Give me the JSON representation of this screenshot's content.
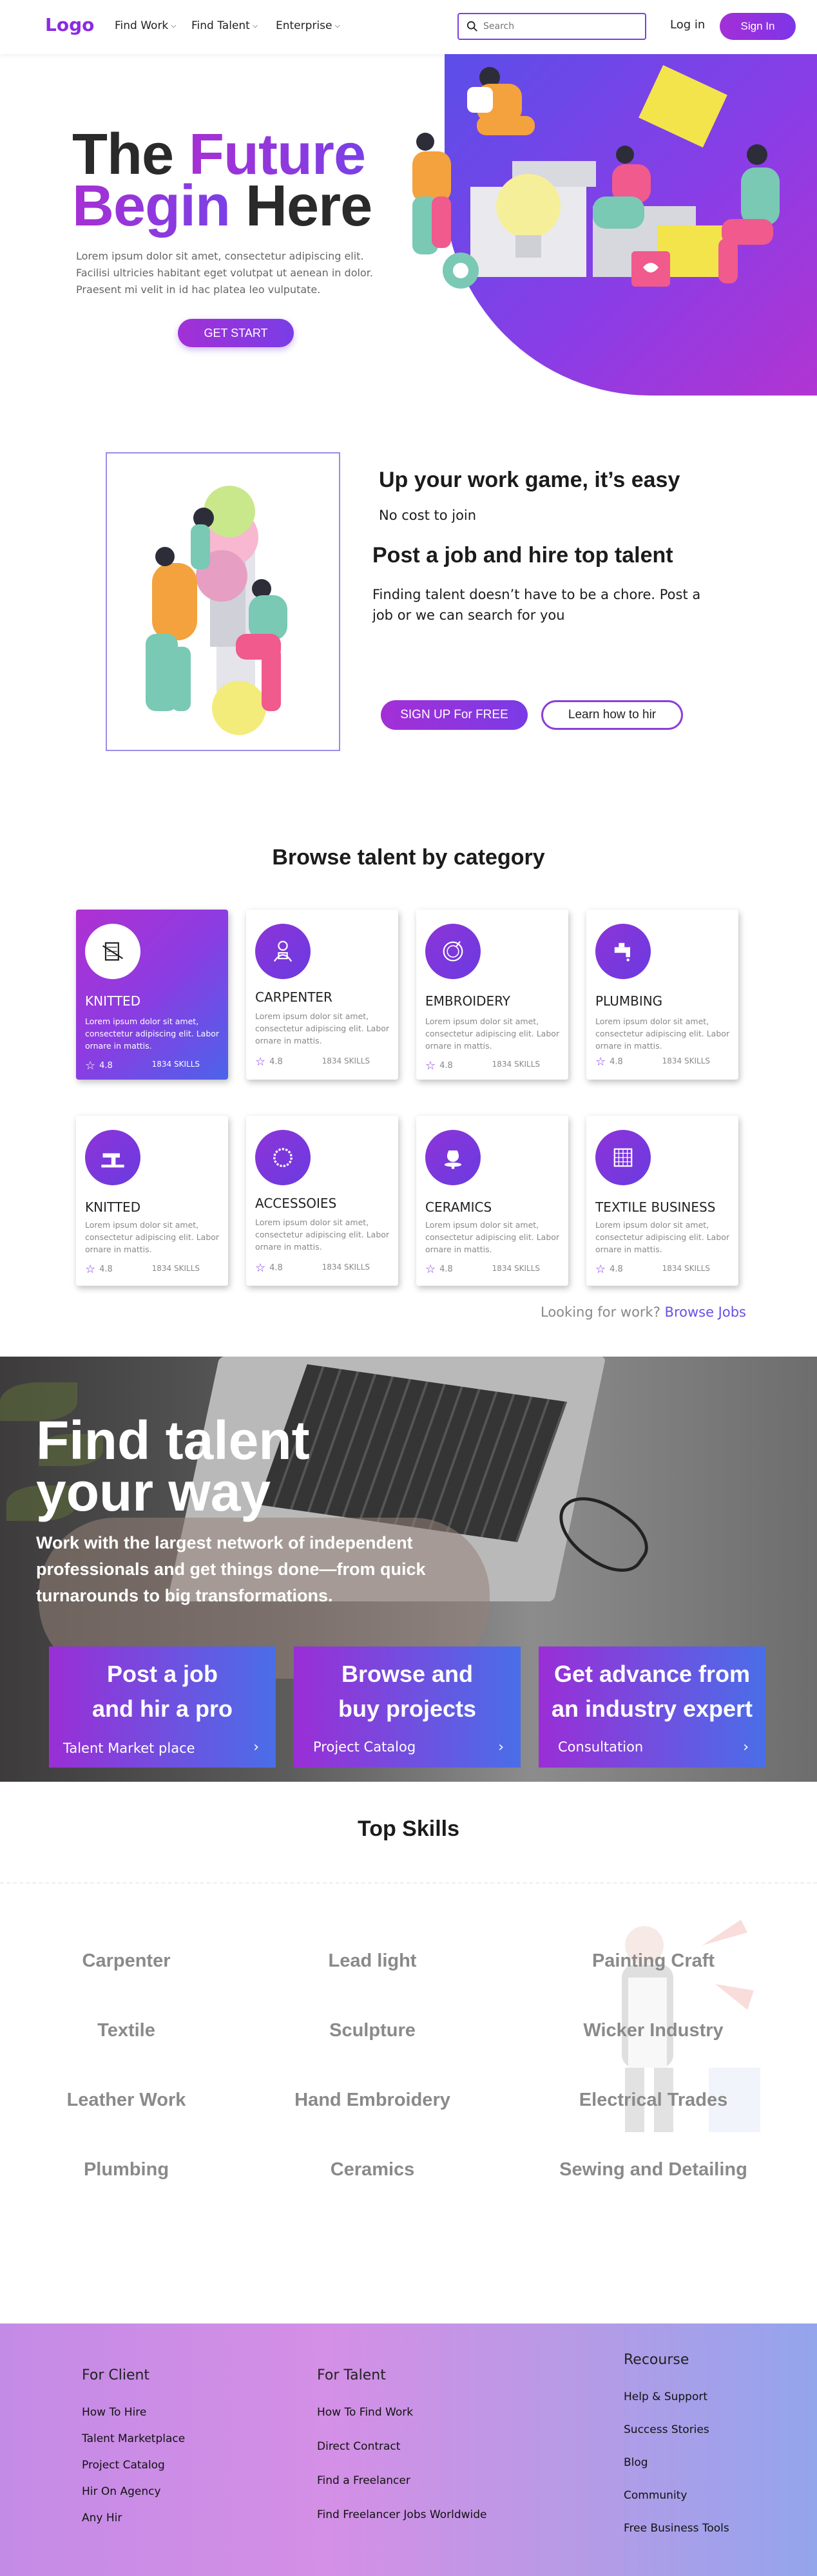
{
  "header": {
    "logo": "Logo",
    "nav": [
      "Find Work",
      "Find Talent",
      "Enterprise"
    ],
    "search_placeholder": "Search",
    "login": "Log in",
    "signin": "Sign In"
  },
  "hero": {
    "title_line1_dark": "The",
    "title_line1_accent": "Future",
    "title_line2_accent": "Begin",
    "title_line2_dark": "Here",
    "subtitle": "Lorem ipsum dolor sit amet, consectetur adipiscing elit. Facilisi ultricies habitant eget volutpat ut aenean in dolor. Praesent mi velit in id hac platea leo vulputate.",
    "cta": "GET START"
  },
  "promo": {
    "heading1": "Up your work game, it’s easy",
    "text1": "No cost to join",
    "heading2": "Post a job and hire top talent",
    "text2": "Finding talent doesn’t have to be a chore. Post a job or we can search for you",
    "signup": "SIGN UP  For FREE",
    "learn": "Learn how to hir"
  },
  "categories": {
    "heading": "Browse talent by category",
    "items": [
      {
        "title": "KNITTED",
        "desc": "Lorem ipsum dolor sit amet, consectetur adipiscing elit. Labor ornare in mattis.",
        "rating": "4.8",
        "skills": "1834 SKILLS",
        "icon": "knitting-icon"
      },
      {
        "title": "CARPENTER",
        "desc": "Lorem ipsum dolor sit amet, consectetur adipiscing elit. Labor ornare in mattis.",
        "rating": "4.8",
        "skills": "1834 SKILLS",
        "icon": "carpenter-icon"
      },
      {
        "title": "EMBROIDERY",
        "desc": "Lorem ipsum dolor sit amet, consectetur adipiscing elit. Labor ornare in mattis.",
        "rating": "4.8",
        "skills": "1834 SKILLS",
        "icon": "embroidery-icon"
      },
      {
        "title": "PLUMBING",
        "desc": "Lorem ipsum dolor sit amet, consectetur adipiscing elit. Labor ornare in mattis.",
        "rating": "4.8",
        "skills": "1834 SKILLS",
        "icon": "faucet-icon"
      },
      {
        "title": "KNITTED",
        "desc": "Lorem ipsum dolor sit amet, consectetur adipiscing elit. Labor ornare in mattis.",
        "rating": "4.8",
        "skills": "1834 SKILLS",
        "icon": "sewing-machine-icon"
      },
      {
        "title": "ACCESSOIES",
        "desc": "Lorem ipsum dolor sit amet, consectetur adipiscing elit. Labor ornare in mattis.",
        "rating": "4.8",
        "skills": "1834 SKILLS",
        "icon": "necklace-icon"
      },
      {
        "title": "CERAMICS",
        "desc": "Lorem ipsum dolor sit amet, consectetur adipiscing elit. Labor ornare in mattis.",
        "rating": "4.8",
        "skills": "1834 SKILLS",
        "icon": "pottery-wheel-icon"
      },
      {
        "title": "TEXTILE BUSINESS",
        "desc": "Lorem ipsum dolor sit amet, consectetur adipiscing elit. Labor ornare in mattis.",
        "rating": "4.8",
        "skills": "1834 SKILLS",
        "icon": "fabric-icon"
      }
    ],
    "looking": "Looking for work?",
    "browse_jobs": "Browse Jobs"
  },
  "find_talent": {
    "title_line1": "Find talent",
    "title_line2": "your way",
    "subtitle": "Work with the largest network of independent professionals and get things done—from quick turnarounds to big transformations.",
    "cards": [
      {
        "title_line1": "Post a  job",
        "title_line2": "and hir a pro",
        "link": "Talent Market place"
      },
      {
        "title_line1": "Browse and",
        "title_line2": "buy projects",
        "link": "Project Catalog"
      },
      {
        "title_line1": "Get advance from",
        "title_line2": "an industry expert",
        "link": "Consultation"
      }
    ]
  },
  "top_skills": {
    "heading": "Top Skills",
    "items": [
      "Carpenter",
      "Lead light",
      "Painting Craft",
      "Textile",
      "Sculpture",
      "Wicker Industry",
      "Leather Work",
      "Hand Embroidery",
      "Electrical Trades",
      "Plumbing",
      "Ceramics",
      "Sewing and Detailing"
    ]
  },
  "footer": {
    "col1": {
      "heading": "For Client",
      "links": [
        "How To Hire",
        "Talent Marketplace",
        "Project Catalog",
        "Hir On Agency",
        "Any Hir"
      ]
    },
    "col2": {
      "heading": "For Talent",
      "links": [
        "How To Find  Work",
        "Direct Contract",
        "Find a Freelancer",
        "Find Freelancer Jobs Worldwide"
      ]
    },
    "col3": {
      "heading": "Recourse",
      "links": [
        "Help & Support",
        "Success Stories",
        "Blog",
        "Community",
        "Free Business Tools"
      ]
    }
  },
  "colors": {
    "accent": "#8a2be2",
    "gradient_start": "#a630d4",
    "gradient_end": "#4a6ee8"
  }
}
